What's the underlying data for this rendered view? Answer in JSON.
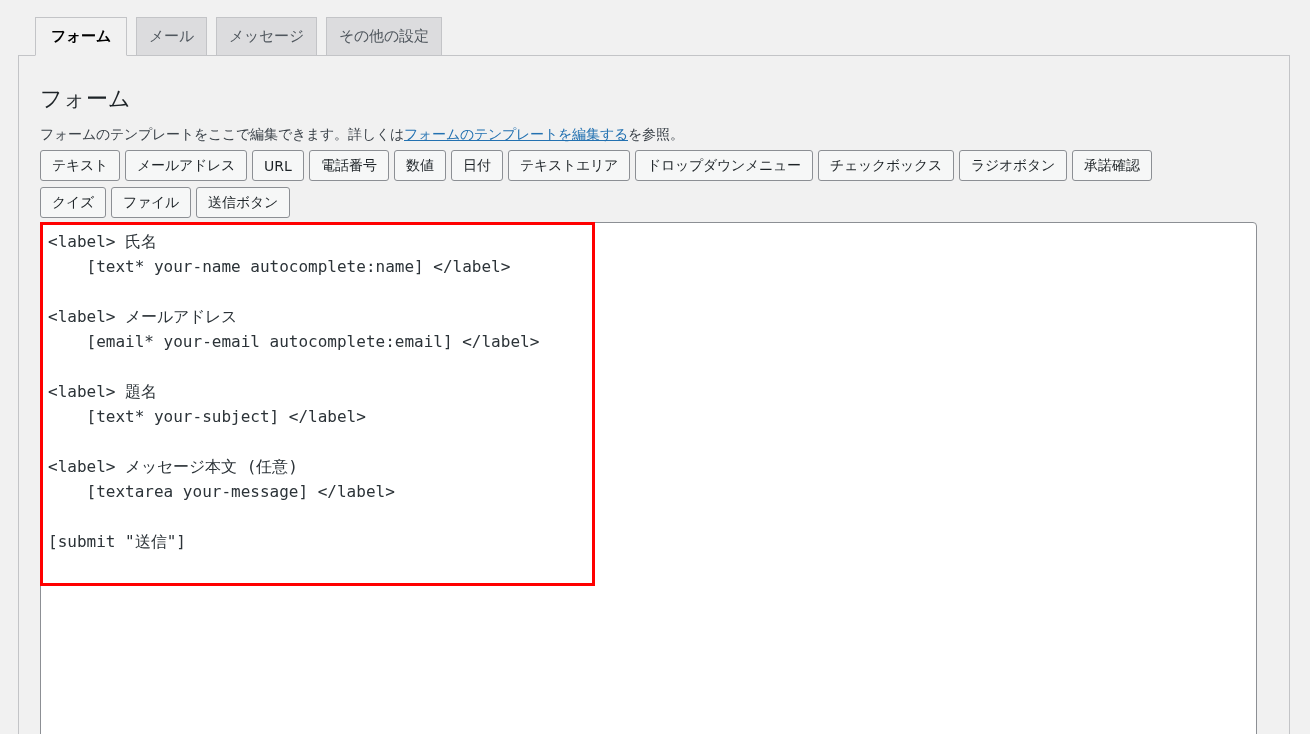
{
  "tabs": [
    {
      "label": "フォーム",
      "selected": true
    },
    {
      "label": "メール",
      "selected": false
    },
    {
      "label": "メッセージ",
      "selected": false
    },
    {
      "label": "その他の設定",
      "selected": false
    }
  ],
  "panel": {
    "heading": "フォーム",
    "description": {
      "before": "フォームのテンプレートをここで編集できます。詳しくは",
      "link": "フォームのテンプレートを編集する",
      "after": "を参照。"
    },
    "tag_buttons": [
      [
        "テキスト",
        "メールアドレス",
        "URL",
        "電話番号",
        "数値",
        "日付",
        "テキストエリア",
        "ドロップダウンメニュー",
        "チェックボックス",
        "ラジオボタン",
        "承諾確認"
      ],
      [
        "クイズ",
        "ファイル",
        "送信ボタン"
      ]
    ],
    "editor": {
      "value": "<label> 氏名\n    [text* your-name autocomplete:name] </label>\n\n<label> メールアドレス\n    [email* your-email autocomplete:email] </label>\n\n<label> 題名\n    [text* your-subject] </label>\n\n<label> メッセージ本文 (任意)\n    [textarea your-message] </label>\n\n[submit \"送信\"]",
      "highlighted": true
    }
  }
}
